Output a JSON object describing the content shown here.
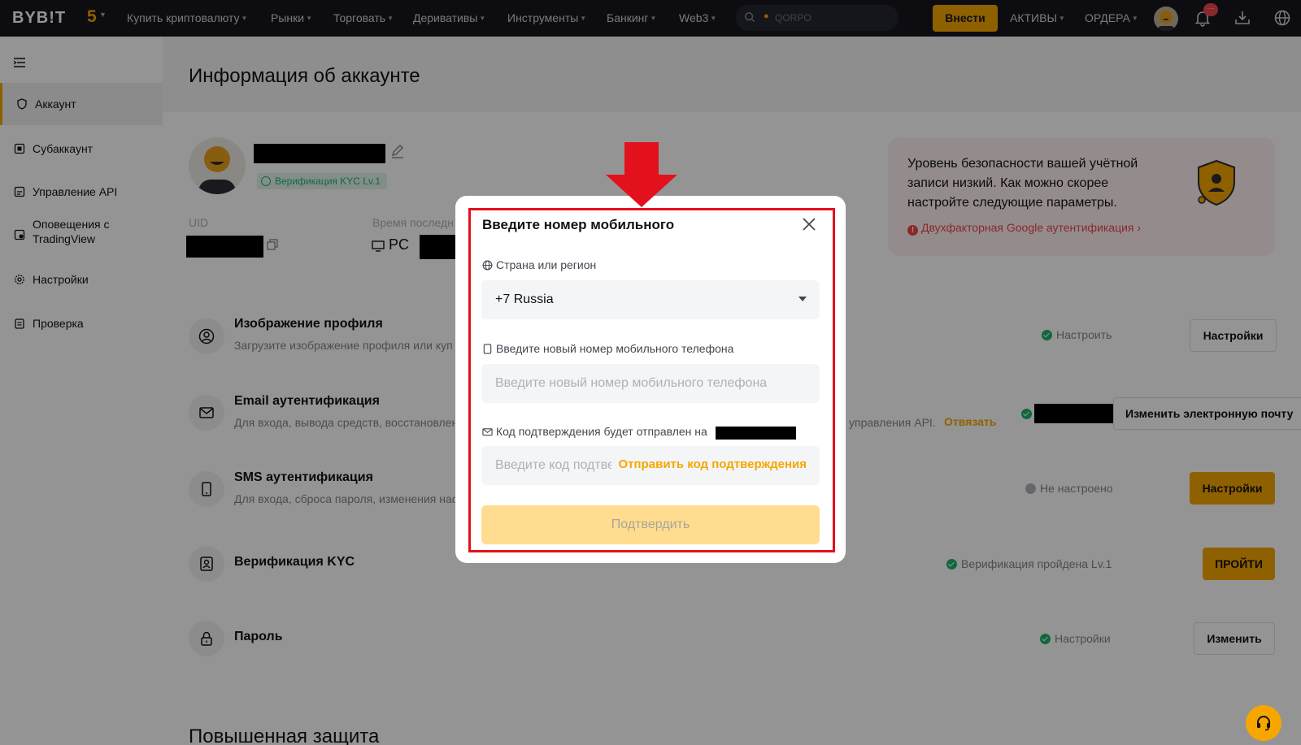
{
  "topnav": {
    "logo": "BYB!T",
    "five": "5",
    "items": [
      {
        "label": "Купить криптовалюту"
      },
      {
        "label": "Рынки"
      },
      {
        "label": "Торговать"
      },
      {
        "label": "Деривативы"
      },
      {
        "label": "Инструменты"
      },
      {
        "label": "Банкинг"
      },
      {
        "label": "Web3"
      }
    ],
    "search_placeholder": "QORPO",
    "deposit_label": "Внести",
    "assets_label": "АКТИВЫ",
    "orders_label": "ОРДЕРА",
    "notification_badge": "···"
  },
  "sidebar": {
    "items": [
      {
        "label": "Аккаунт",
        "icon": "shield-icon"
      },
      {
        "label": "Субаккаунт",
        "icon": "subaccount-icon"
      },
      {
        "label": "Управление API",
        "icon": "api-icon"
      },
      {
        "label": "Оповещения с TradingView",
        "icon": "tradingview-icon"
      },
      {
        "label": "Настройки",
        "icon": "gear-icon"
      },
      {
        "label": "Проверка",
        "icon": "clipboard-icon"
      }
    ]
  },
  "main": {
    "page_title": "Информация об аккаунте",
    "kyc_chip": "Верификация KYC Lv.1",
    "uid_label": "UID",
    "last_login_label": "Время последн",
    "device": "PC",
    "security": {
      "text": "Уровень безопасности вашей учётной записи низкий. Как можно скорее настройте следующие параметры.",
      "link": "Двухфакторная Google аутентификация ›"
    },
    "rows": [
      {
        "title": "Изображение профиля",
        "desc": "Загрузите изображение профиля или куп",
        "status": "Настроить",
        "button": "Настройки"
      },
      {
        "title": "Email аутентификация",
        "desc": "Для входа, вывода средств, восстановлен",
        "desc_right": "управления API.",
        "action": "Отвязать",
        "button": "Изменить электронную почту"
      },
      {
        "title": "SMS аутентификация",
        "desc": "Для входа, сброса пароля, изменения нас",
        "status": "Не настроено",
        "button": "Настройки"
      },
      {
        "title": "Верификация KYC",
        "status": "Верификация пройдена Lv.1",
        "button": "ПРОЙТИ"
      },
      {
        "title": "Пароль",
        "status": "Настройки",
        "button": "Изменить"
      }
    ],
    "section_title": "Повышенная защита"
  },
  "modal": {
    "title": "Введите номер мобильного",
    "country_label": "Страна или регион",
    "country_value": "+7 Russia",
    "phone_label": "Введите новый номер мобильного телефона",
    "phone_placeholder": "Введите новый номер мобильного телефона",
    "code_label": "Код подтверждения будет отправлен на",
    "code_placeholder": "Введите код подтверждения",
    "send_code": "Отправить код подтверждения",
    "confirm": "Подтвердить"
  },
  "colors": {
    "brand": "#f7a600",
    "annotation_red": "#e3111c",
    "success": "#20b26c",
    "danger": "#ef454a"
  }
}
